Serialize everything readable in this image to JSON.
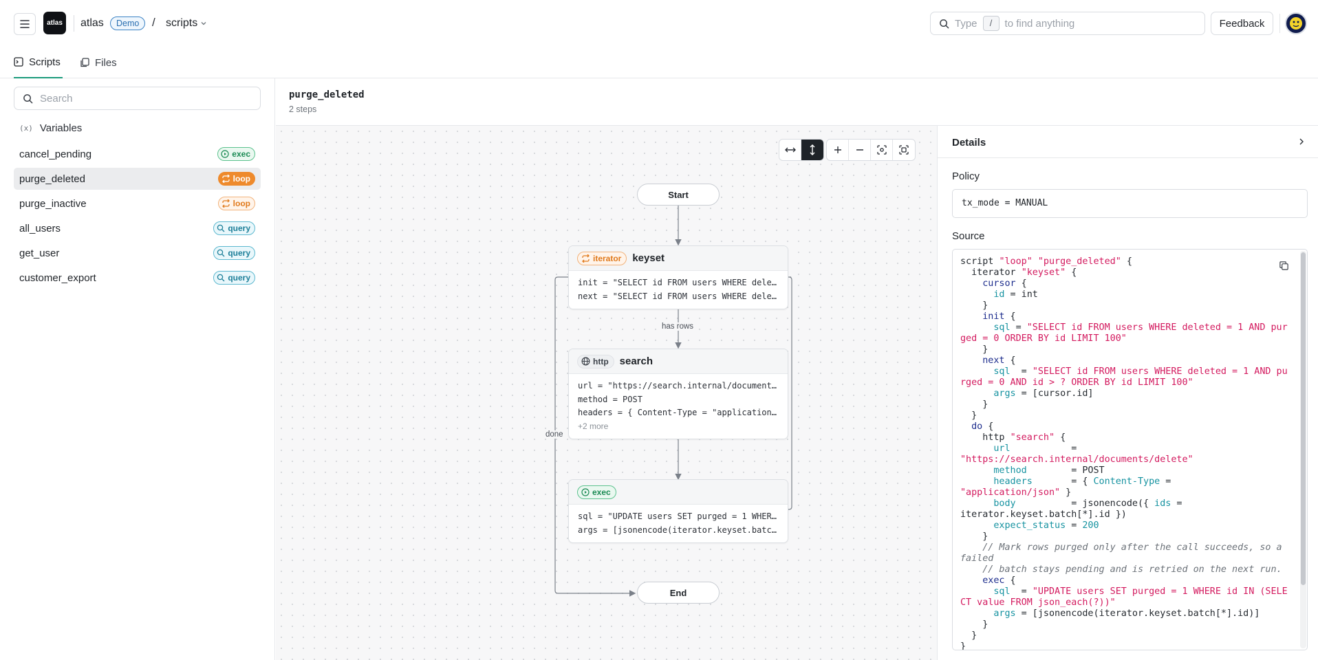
{
  "app": {
    "logo_text": "atlas",
    "name": "atlas",
    "env_badge": "Demo",
    "separator": "/",
    "section": "scripts"
  },
  "search": {
    "placeholder_before": "Type",
    "shortcut": "/",
    "placeholder_after": "to find anything"
  },
  "header": {
    "feedback_label": "Feedback"
  },
  "tabs": [
    {
      "label": "Scripts",
      "active": true
    },
    {
      "label": "Files",
      "active": false
    }
  ],
  "sidebar": {
    "search_placeholder": "Search",
    "variables_label": "Variables",
    "items": [
      {
        "name": "cancel_pending",
        "badge": "exec",
        "type": "exec"
      },
      {
        "name": "purge_deleted",
        "badge": "loop",
        "type": "loop",
        "selected": true
      },
      {
        "name": "purge_inactive",
        "badge": "loop",
        "type": "loop"
      },
      {
        "name": "all_users",
        "badge": "query",
        "type": "query"
      },
      {
        "name": "get_user",
        "badge": "query",
        "type": "query"
      },
      {
        "name": "customer_export",
        "badge": "query",
        "type": "query"
      }
    ]
  },
  "script": {
    "title": "purge_deleted",
    "subtitle": "2 steps"
  },
  "flow": {
    "start_label": "Start",
    "end_label": "End",
    "edge_has_rows": "has rows",
    "edge_done": "done",
    "nodes": [
      {
        "badge": "iterator",
        "name": "keyset",
        "lines": [
          "init = \"SELECT id FROM users WHERE deleted = 1 AND purged = 0 ORDER BY id LIMIT 100\"",
          "next = \"SELECT id FROM users WHERE deleted = 1 AND purged = 0 AND id > ? ORDER BY id LIMIT 100\""
        ]
      },
      {
        "badge": "http",
        "name": "search",
        "lines": [
          "url = \"https://search.internal/documents/delete\"",
          "method = POST",
          "headers = { Content-Type = \"application/json\" }"
        ],
        "more": "+2 more"
      },
      {
        "badge": "exec",
        "name": "",
        "lines": [
          "sql = \"UPDATE users SET purged = 1 WHERE id IN (SELECT value FROM json_each(?))\"",
          "args = [jsonencode(iterator.keyset.batch[*].id)]"
        ]
      }
    ]
  },
  "details": {
    "title": "Details",
    "policy_label": "Policy",
    "policy_value": "tx_mode = MANUAL",
    "source_label": "Source"
  },
  "colors": {
    "accent": "#1a9a7b",
    "exec": "#1a8a53",
    "loop": "#ee8a2c",
    "query": "#1d7f99"
  }
}
